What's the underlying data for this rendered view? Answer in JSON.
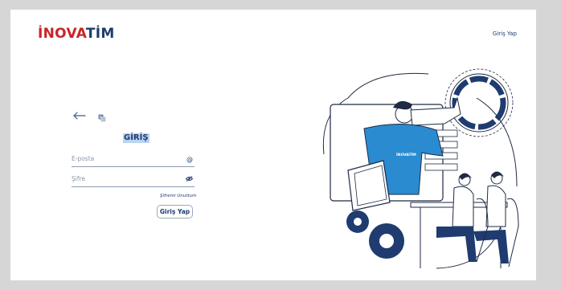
{
  "brand": {
    "logo_part1": "İNOVA",
    "logo_part2": "TİM"
  },
  "header": {
    "login_link": "Giriş Yap"
  },
  "form": {
    "title": "GİRİŞ",
    "email_placeholder": "E-posta",
    "password_placeholder": "Şifre",
    "forgot_label": "Şifremi Unuttum",
    "submit_label": "Giriş Yap"
  },
  "illustration": {
    "shirt_text": "İNOVATİM"
  },
  "colors": {
    "brand_red": "#c8242b",
    "brand_navy": "#1f3b6f",
    "accent_blue": "#2a8bd0"
  },
  "icons": [
    "arrow-left-icon",
    "translate-icon",
    "at-icon",
    "eye-off-icon"
  ]
}
